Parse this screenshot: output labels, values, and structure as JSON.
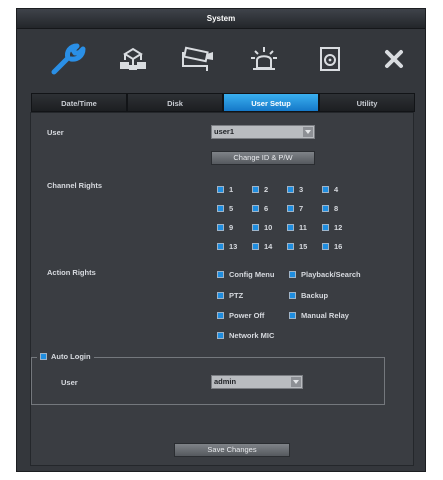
{
  "window": {
    "title": "System"
  },
  "toolbar": {
    "icons": [
      "wrench-icon",
      "network-icon",
      "camera-icon",
      "alarm-icon",
      "disk-icon",
      "close-icon"
    ],
    "active_color": "#2a8fe6",
    "icon_color": "#d9dce0"
  },
  "tabs": [
    {
      "label": "Date/Time",
      "active": false
    },
    {
      "label": "Disk",
      "active": false
    },
    {
      "label": "User Setup",
      "active": true
    },
    {
      "label": "Utility",
      "active": false
    }
  ],
  "user_setup": {
    "user_label": "User",
    "user_value": "user1",
    "change_button": "Change ID & P/W",
    "channel_rights_label": "Channel Rights",
    "channels": [
      "1",
      "2",
      "3",
      "4",
      "5",
      "6",
      "7",
      "8",
      "9",
      "10",
      "11",
      "12",
      "13",
      "14",
      "15",
      "16"
    ],
    "action_rights_label": "Action Rights",
    "actions": [
      "Config Menu",
      "Playback/Search",
      "PTZ",
      "Backup",
      "Power Off",
      "Manual Relay",
      "Network MIC"
    ],
    "auto_login": {
      "label": "Auto Login",
      "user_label": "User",
      "user_value": "admin"
    },
    "save_button": "Save Changes"
  },
  "colors": {
    "tab_active": "#2a98e8",
    "checkbox": "#1f8ee0",
    "panel": "#3a3d42"
  }
}
